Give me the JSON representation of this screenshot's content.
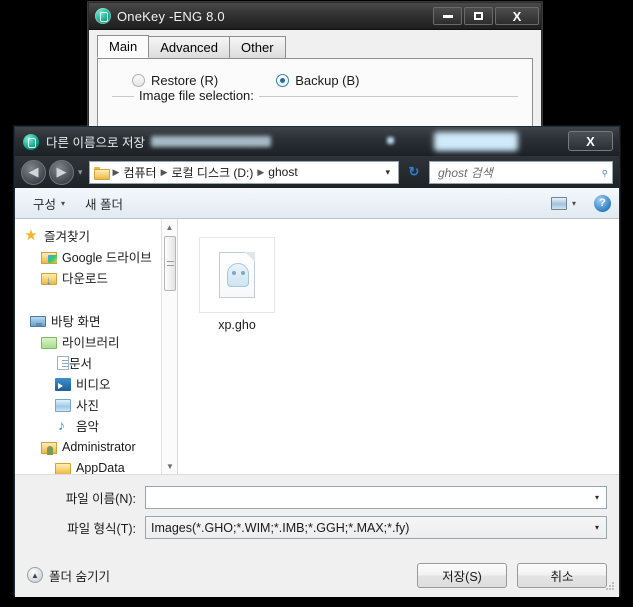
{
  "onekey_window": {
    "title": "OneKey -ENG 8.0",
    "app_icon": "onekey-logo-icon",
    "window_buttons": {
      "minimize": "minimize-icon",
      "maximize": "maximize-icon",
      "close": "X"
    },
    "tabs": [
      {
        "label": "Main",
        "active": true
      },
      {
        "label": "Advanced",
        "active": false
      },
      {
        "label": "Other",
        "active": false
      }
    ],
    "radios": [
      {
        "label": "Restore (R)",
        "checked": false
      },
      {
        "label": "Backup (B)",
        "checked": true
      }
    ],
    "groupbox_label": "Image file selection:"
  },
  "dialog": {
    "title": "다른 이름으로 저장",
    "app_icon": "onekey-logo-icon",
    "close_label": "X",
    "nav": {
      "back_icon": "back-arrow-icon",
      "forward_icon": "forward-arrow-icon",
      "history_caret": "▾",
      "breadcrumb": [
        {
          "label": "컴퓨터"
        },
        {
          "label": "로컬 디스크 (D:)"
        },
        {
          "label": "ghost"
        }
      ],
      "address_dropdown": "▾",
      "refresh_icon": "refresh-icon",
      "search_placeholder": "ghost 검색",
      "search_value": "",
      "search_icon": "search-icon"
    },
    "toolbar": {
      "organize": "구성",
      "organize_caret": "▾",
      "new_folder": "새 폴더",
      "view_icon": "view-mode-icon",
      "view_caret": "▾",
      "help_icon": "?"
    },
    "nav_pane": {
      "items": [
        {
          "label": "즐겨찾기",
          "icon": "favorites-star-icon",
          "indent": 0
        },
        {
          "label": "Google 드라이브",
          "icon": "google-drive-folder-icon",
          "indent": 1
        },
        {
          "label": "다운로드",
          "icon": "downloads-folder-icon",
          "indent": 1
        },
        {
          "label": "",
          "icon": "spacer",
          "indent": 0
        },
        {
          "label": "바탕 화면",
          "icon": "desktop-monitor-icon",
          "indent": 0
        },
        {
          "label": "라이브러리",
          "icon": "libraries-folder-icon",
          "indent": 1
        },
        {
          "label": "문서",
          "icon": "documents-icon",
          "indent": 2
        },
        {
          "label": "비디오",
          "icon": "videos-icon",
          "indent": 2
        },
        {
          "label": "사진",
          "icon": "pictures-icon",
          "indent": 2
        },
        {
          "label": "음악",
          "icon": "music-icon",
          "indent": 2
        },
        {
          "label": "Administrator",
          "icon": "user-folder-icon",
          "indent": 1
        },
        {
          "label": "AppData",
          "icon": "folder-icon",
          "indent": 2
        }
      ],
      "scrollbar": {
        "up_arrow": "▲",
        "down_arrow": "▼",
        "thumb": "scrollbar-thumb"
      }
    },
    "file_list": {
      "files": [
        {
          "name": "xp.gho",
          "icon": "ghost-image-file-icon",
          "selected": false
        }
      ]
    },
    "form": {
      "file_name_label": "파일 이름(N):",
      "file_name_value": "",
      "file_type_label": "파일 형식(T):",
      "file_type_value": "Images(*.GHO;*.WIM;*.IMB;*.GGH;*.MAX;*.fy)",
      "dropdown_caret": "▾"
    },
    "footer": {
      "hide_folders_label": "폴더 숨기기",
      "hide_folders_icon": "▲",
      "save_label": "저장(S)",
      "cancel_label": "취소"
    }
  },
  "colors": {
    "accent_blue": "#2f7fc4",
    "folder_yellow": "#e8b84b",
    "dark_titlebar": "#2b3036",
    "radio_selected": "#1d6fa5"
  }
}
